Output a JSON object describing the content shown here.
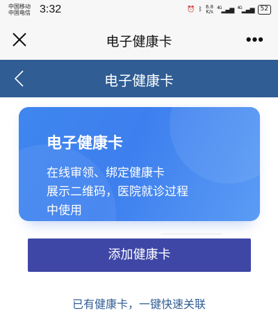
{
  "status_bar": {
    "carrier_1": "中国移动",
    "carrier_2": "中国电信",
    "time": "3:32",
    "speed_value": "6.8",
    "speed_unit": "K/s",
    "battery": "52",
    "signal_1": "4G",
    "signal_2": "4G"
  },
  "wechat_header": {
    "title": "电子健康卡",
    "close_icon": "close-icon",
    "more_icon": "more-icon",
    "more_label": "•••"
  },
  "app_bar": {
    "title": "电子健康卡",
    "back_icon": "chevron-left-icon"
  },
  "card": {
    "title": "电子健康卡",
    "desc_line1": "在线审领、绑定健康卡",
    "desc_line2": "展示二维码，医院就诊过程",
    "desc_line3": "中使用"
  },
  "actions": {
    "add_button": "添加健康卡",
    "link": "已有健康卡，一键快速关联"
  },
  "colors": {
    "app_bar_bg": "#2f5d94",
    "card_bg": "#3f86ef",
    "button_bg": "#3e47a6",
    "link_color": "#2f5d94"
  }
}
